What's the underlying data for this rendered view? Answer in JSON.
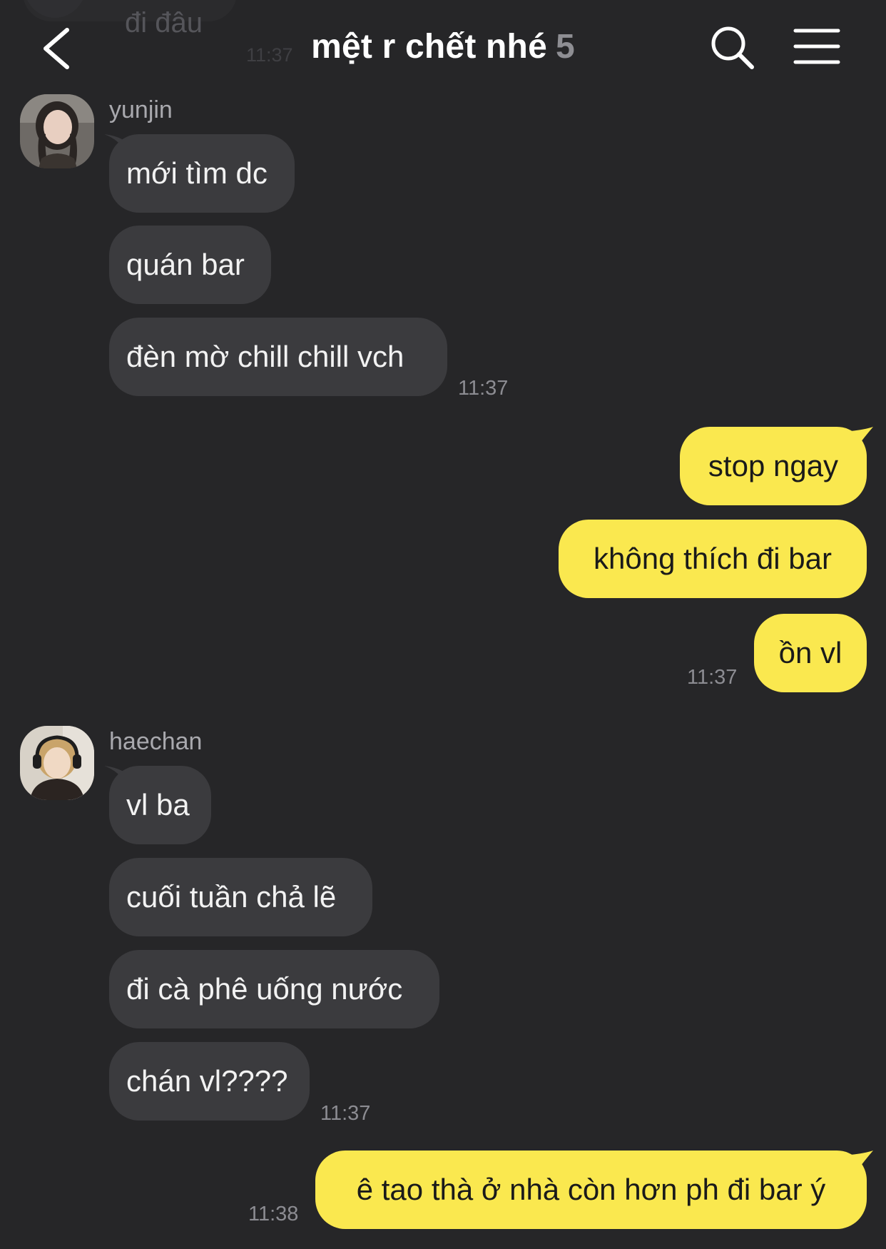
{
  "header": {
    "ghost_message": "đi đâu",
    "ghost_time": "11:37",
    "title": "mệt r chết nhé",
    "member_count": "5"
  },
  "colors": {
    "background": "#262628",
    "incoming_bubble": "#3b3b3e",
    "outgoing_bubble": "#fae84f",
    "timestamp": "#8c8c92"
  },
  "messages": {
    "yunjin": {
      "sender": "yunjin",
      "lines": [
        "mới tìm dc",
        "quán bar",
        "đèn mờ chill chill vch"
      ],
      "time": "11:37"
    },
    "me1": {
      "lines": [
        "stop ngay",
        "không thích đi bar",
        "ồn vl"
      ],
      "time": "11:37"
    },
    "haechan": {
      "sender": "haechan",
      "lines": [
        "vl ba",
        "cuối tuần chả lẽ",
        "đi cà phê uống nước",
        "chán vl????"
      ],
      "time": "11:37"
    },
    "me2": {
      "lines": [
        "ê tao thà ở nhà còn hơn ph đi bar ý"
      ],
      "time": "11:38"
    }
  }
}
